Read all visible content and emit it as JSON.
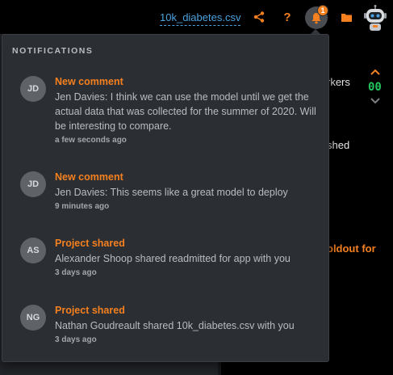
{
  "header": {
    "filename": "10k_diabetes.csv",
    "help_label": "?",
    "notification_badge": "1",
    "accent_color": "#f5801f",
    "link_color": "#4aa3e0",
    "icons": [
      "share-icon",
      "help-icon",
      "bell-icon",
      "folder-icon",
      "robot-avatar"
    ]
  },
  "background": {
    "workers_text": "rkers",
    "counter_text": "00",
    "finished_text": "shed",
    "holdout_text": "oldout for"
  },
  "notifications": {
    "heading": "NOTIFICATIONS",
    "items": [
      {
        "initials": "JD",
        "title": "New comment",
        "message": "Jen Davies: I think we can use the model until we get the actual data that was collected for the summer of 2020. Will be interesting to compare.",
        "time": "a few seconds ago"
      },
      {
        "initials": "JD",
        "title": "New comment",
        "message": "Jen Davies: This seems like a great model to deploy",
        "time": "9 minutes ago"
      },
      {
        "initials": "AS",
        "title": "Project shared",
        "message": "Alexander Shoop shared readmitted for app with you",
        "time": "3 days ago"
      },
      {
        "initials": "NG",
        "title": "Project shared",
        "message": "Nathan Goudreault shared 10k_diabetes.csv with you",
        "time": "3 days ago"
      }
    ]
  }
}
